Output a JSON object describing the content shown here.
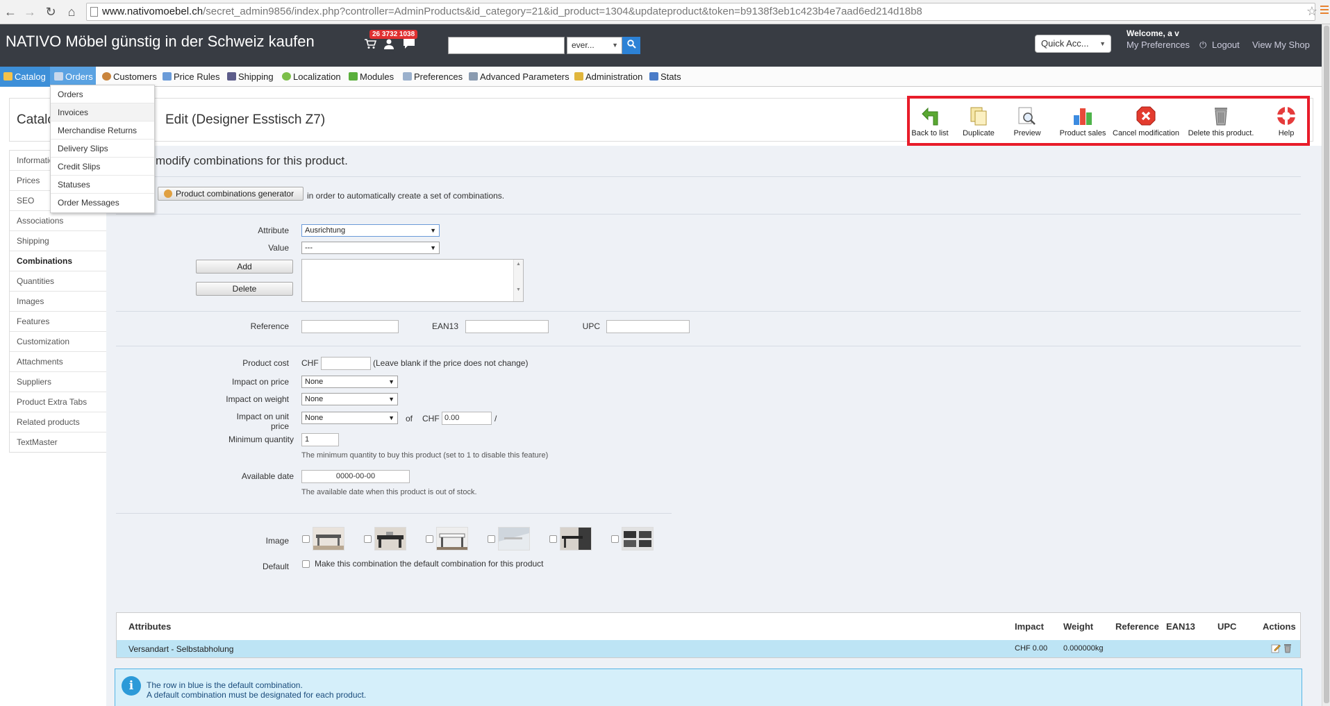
{
  "browser": {
    "url_host": "www.nativomoebel.ch",
    "url_rest": "/secret_admin9856/index.php?controller=AdminProducts&id_category=21&id_product=1304&updateproduct&token=b9138f3eb1c423b4e7aad6ed214d18b8"
  },
  "header": {
    "shop_name": "NATIVO Möbel günstig in der Schweiz kaufen",
    "notifications": "26 3732 1038",
    "search_value": "",
    "search_scope": "ever...",
    "quick_access": "Quick Acc...",
    "welcome": "Welcome, a v",
    "my_preferences": "My Preferences",
    "logout": "Logout",
    "view_shop": "View My Shop"
  },
  "tabs": [
    {
      "label": "Catalog"
    },
    {
      "label": "Orders"
    },
    {
      "label": "Customers"
    },
    {
      "label": "Price Rules"
    },
    {
      "label": "Shipping"
    },
    {
      "label": "Localization"
    },
    {
      "label": "Modules"
    },
    {
      "label": "Preferences"
    },
    {
      "label": "Advanced Parameters"
    },
    {
      "label": "Administration"
    },
    {
      "label": "Stats"
    }
  ],
  "orders_menu": [
    "Orders",
    "Invoices",
    "Merchandise Returns",
    "Delivery Slips",
    "Credit Slips",
    "Statuses",
    "Order Messages"
  ],
  "page": {
    "breadcrumb": "Catalog",
    "title": "Edit (Designer Esstisch Z7)",
    "section_heading": "modify combinations for this product."
  },
  "toolbar": {
    "back": "Back to list",
    "duplicate": "Duplicate",
    "preview": "Preview",
    "sales": "Product sales",
    "cancel": "Cancel modification",
    "delete": "Delete this product.",
    "help": "Help"
  },
  "sidebar": [
    "Information",
    "Prices",
    "SEO",
    "Associations",
    "Shipping",
    "Combinations",
    "Quantities",
    "Images",
    "Features",
    "Customization",
    "Attachments",
    "Suppliers",
    "Product Extra Tabs",
    "Related products",
    "TextMaster"
  ],
  "form": {
    "generator_button": "Product combinations generator",
    "generator_text": "in order to automatically create a set of combinations.",
    "attribute_label": "Attribute",
    "attribute_value": "Ausrichtung",
    "value_label": "Value",
    "value_value": "---",
    "add_button": "Add",
    "delete_button": "Delete",
    "reference_label": "Reference",
    "ean13_label": "EAN13",
    "upc_label": "UPC",
    "product_cost_label": "Product cost",
    "currency": "CHF",
    "product_cost_hint": "(Leave blank if the price does not change)",
    "impact_price_label": "Impact on price",
    "impact_price_value": "None",
    "impact_weight_label": "Impact on weight",
    "impact_weight_value": "None",
    "impact_unit_label_1": "Impact on unit",
    "impact_unit_label_2": "price",
    "impact_unit_value": "None",
    "of_text": "of",
    "unit_currency": "CHF",
    "unit_price_value": "0.00",
    "slash": "/",
    "min_qty_label": "Minimum quantity",
    "min_qty_value": "1",
    "min_qty_hint": "The minimum quantity to buy this product (set to 1 to disable this feature)",
    "available_date_label": "Available date",
    "available_date_value": "0000-00-00",
    "available_date_hint": "The available date when this product is out of stock.",
    "image_label": "Image",
    "default_label": "Default",
    "default_checkbox_text": "Make this combination the default combination for this product"
  },
  "table": {
    "headers": [
      "Attributes",
      "Impact",
      "Weight",
      "Reference",
      "EAN13",
      "UPC",
      "Actions"
    ],
    "rows": [
      {
        "attributes": "Versandart - Selbstabholung",
        "impact": "CHF 0.00",
        "weight": "0.000000kg",
        "reference": "",
        "ean13": "",
        "upc": ""
      }
    ]
  },
  "info": {
    "line1": "The row in blue is the default combination.",
    "line2": "A default combination must be designated for each product."
  },
  "colors": {
    "accent": "#3d8fd8",
    "highlight": "#e81c2a",
    "default_row": "#bde4f5"
  }
}
